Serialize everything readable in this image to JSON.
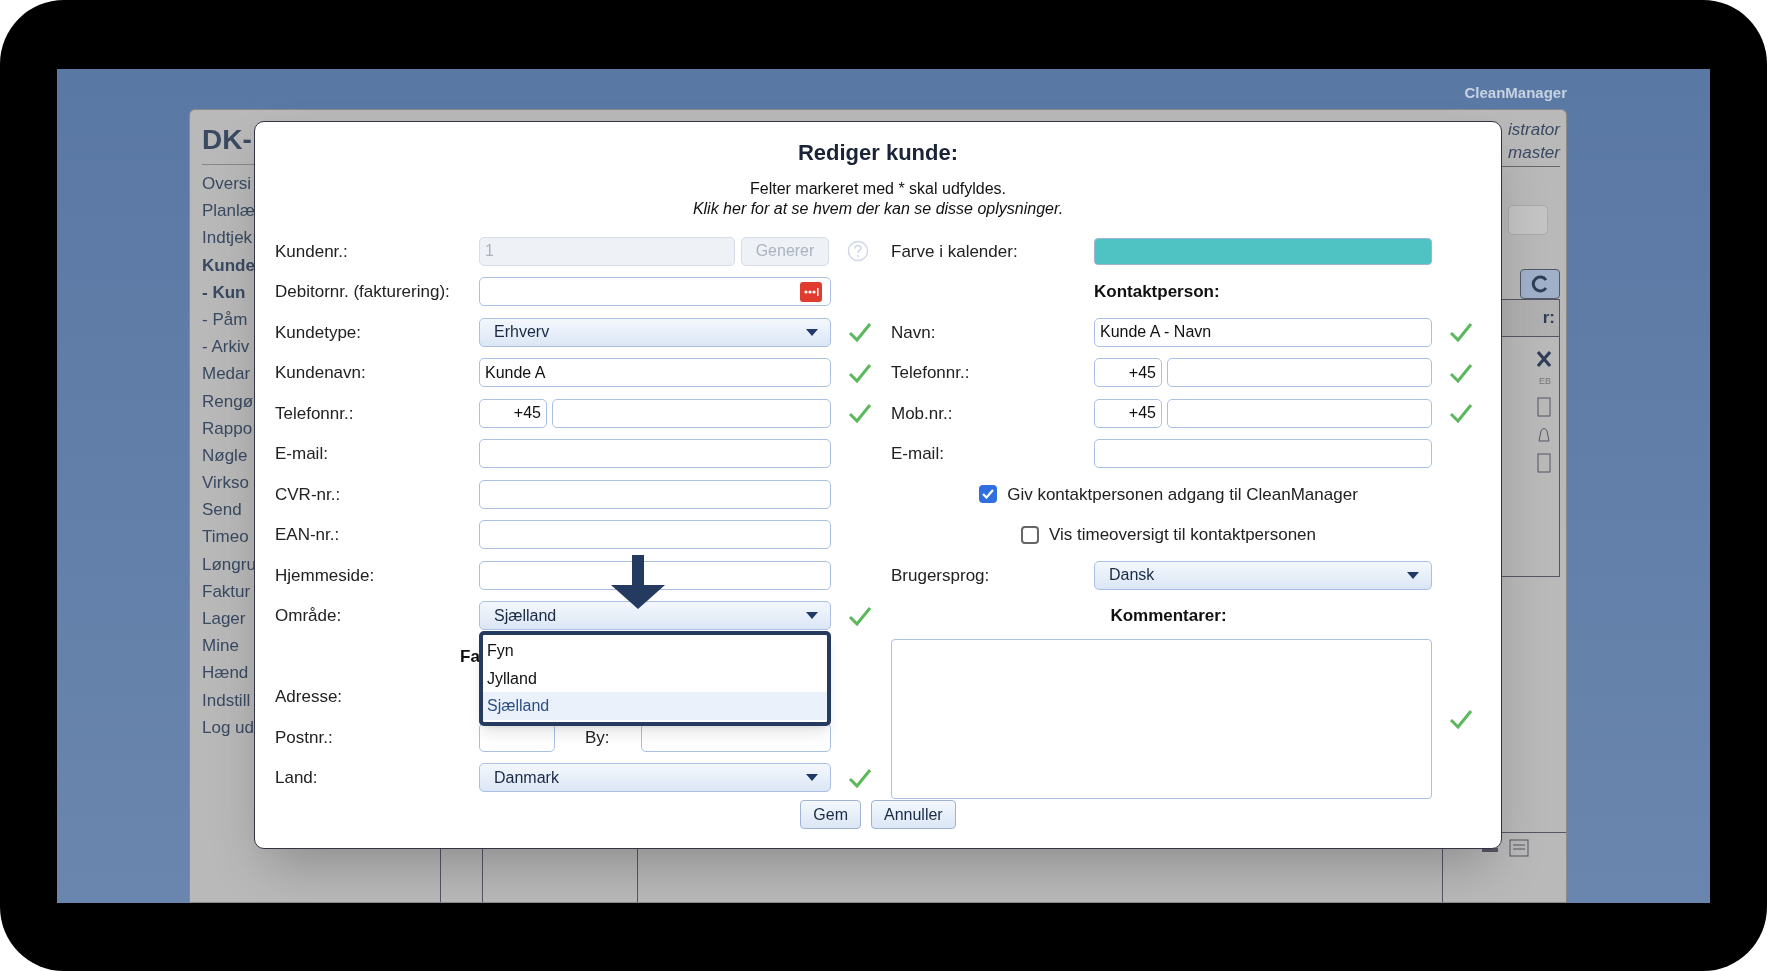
{
  "background": {
    "brand": "CleanManager",
    "sidebar": {
      "title": "DK-",
      "items": [
        {
          "label": "Oversi",
          "bold": false
        },
        {
          "label": "Planlæ",
          "bold": false
        },
        {
          "label": "Indtjek",
          "bold": false
        },
        {
          "label": "Kunde",
          "bold": true
        },
        {
          "label": "- Kun",
          "bold": true
        },
        {
          "label": "- Påm",
          "bold": false
        },
        {
          "label": "- Arkiv",
          "bold": false
        },
        {
          "label": "Medar",
          "bold": false
        },
        {
          "label": "Rengø",
          "bold": false
        },
        {
          "label": "Rappo",
          "bold": false
        },
        {
          "label": "Nøgle",
          "bold": false
        },
        {
          "label": "Virkso",
          "bold": false
        },
        {
          "label": "Send",
          "bold": false
        },
        {
          "label": "Timeo",
          "bold": false
        },
        {
          "label": "Løngru",
          "bold": false
        },
        {
          "label": "Faktur",
          "bold": false
        },
        {
          "label": "Lager",
          "bold": false
        },
        {
          "label": "Mine",
          "bold": false
        },
        {
          "label": "Hænd",
          "bold": false
        },
        {
          "label": "Indstill",
          "bold": false
        },
        {
          "label": "Log ud",
          "bold": false
        }
      ]
    },
    "user": [
      "istrator",
      "master"
    ],
    "header_cell": "r:",
    "small_label": "EB"
  },
  "dialog": {
    "title": "Rediger kunde:",
    "note": "Felter markeret med * skal udfyldes.",
    "link": "Klik her for at se hvem der kan se disse oplysninger.",
    "left": [
      {
        "kind": "id",
        "label": "Kundenr.:",
        "value": "1",
        "button": "Generer",
        "disabled": true
      },
      {
        "kind": "password",
        "label": "Debitornr. (fakturering):"
      },
      {
        "kind": "select",
        "label": "Kundetype:",
        "value": "Erhverv",
        "valid": true
      },
      {
        "kind": "text",
        "label": "Kundenavn:",
        "value": "Kunde A",
        "valid": true
      },
      {
        "kind": "phone",
        "label": "Telefonnr.:",
        "prefix": "+45",
        "valid": true
      },
      {
        "kind": "text",
        "label": "E-mail:"
      },
      {
        "kind": "text",
        "label": "CVR-nr.:"
      },
      {
        "kind": "text",
        "label": "EAN-nr.:"
      },
      {
        "kind": "text",
        "label": "Hjemmeside:"
      },
      {
        "kind": "select",
        "label": "Område:",
        "value": "Sjælland",
        "valid": true,
        "expanded": true,
        "options": [
          {
            "label": "Fyn",
            "selected": false
          },
          {
            "label": "Jylland",
            "selected": false
          },
          {
            "label": "Sjælland",
            "selected": true
          }
        ]
      },
      {
        "kind": "heading",
        "label": "Fa"
      },
      {
        "kind": "label",
        "label": "Adresse:"
      },
      {
        "kind": "postal",
        "label": "Postnr.:",
        "city_label": "By:"
      },
      {
        "kind": "select",
        "label": "Land:",
        "value": "Danmark",
        "valid": true
      }
    ],
    "right": [
      {
        "kind": "color",
        "label": "Farve i kalender:",
        "color": "#4fc3c3"
      },
      {
        "kind": "heading",
        "label": "Kontaktperson:"
      },
      {
        "kind": "text",
        "label": "Navn:",
        "value": "Kunde A - Navn",
        "valid": true
      },
      {
        "kind": "phone",
        "label": "Telefonnr.:",
        "prefix": "+45",
        "valid": true
      },
      {
        "kind": "phone",
        "label": "Mob.nr.:",
        "prefix": "+45",
        "valid": true
      },
      {
        "kind": "text",
        "label": "E-mail:"
      },
      {
        "kind": "checkbox",
        "label": "Giv kontaktpersonen adgang til CleanManager",
        "checked": true
      },
      {
        "kind": "checkbox",
        "label": "Vis timeoversigt til kontaktpersonen",
        "checked": false
      },
      {
        "kind": "select",
        "label": "Brugersprog:",
        "value": "Dansk"
      },
      {
        "kind": "center_heading",
        "label": "Kommentarer:"
      },
      {
        "kind": "textarea",
        "valid": true
      }
    ],
    "buttons": [
      "Gem",
      "Annuller"
    ]
  }
}
